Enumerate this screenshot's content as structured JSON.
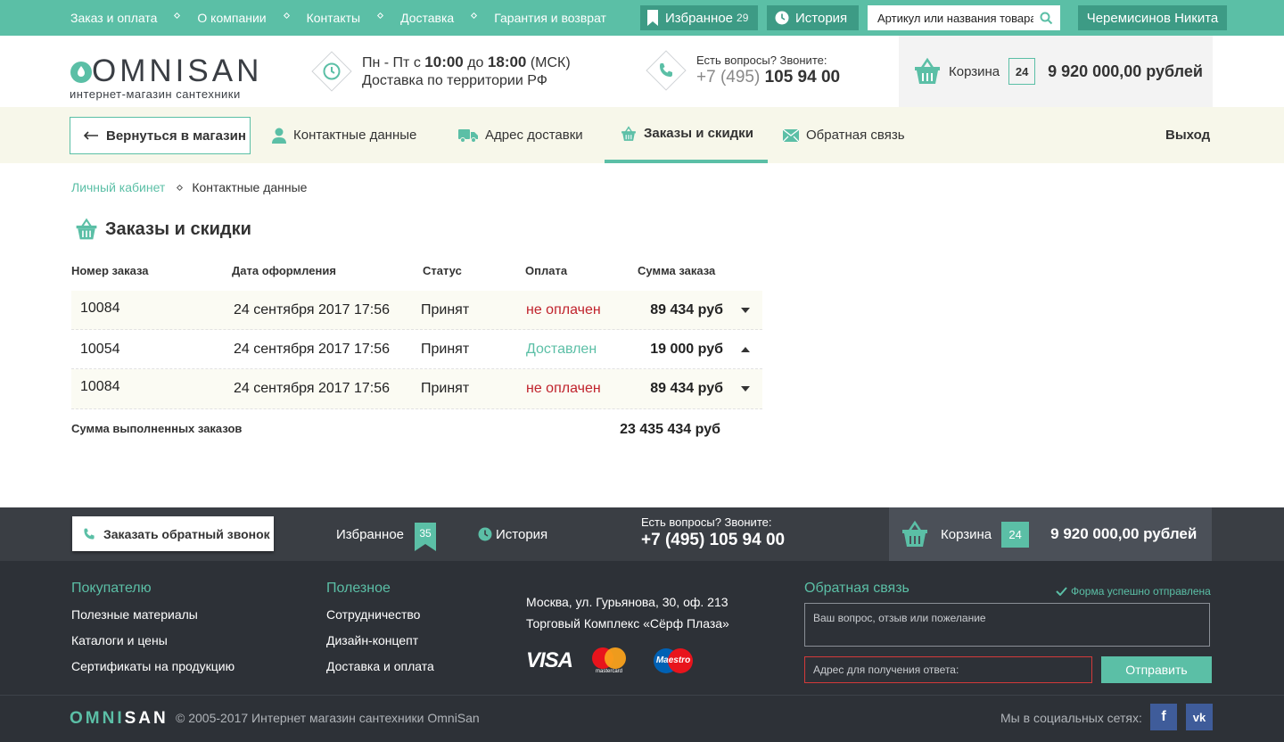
{
  "topbar": {
    "nav": [
      "Заказ и оплата",
      "О компании",
      "Контакты",
      "Доставка",
      "Гарантия и возврат"
    ],
    "favorites_label": "Избранное",
    "favorites_count": "29",
    "history_label": "История",
    "search_placeholder": "Артикул или названия товара",
    "user_name": "Черемисинов Никита"
  },
  "header": {
    "logo_omni": "OMNI",
    "logo_san": "SAN",
    "logo_sub": "интернет-магазин сантехники",
    "hours_prefix": "Пн - Пт с",
    "hours_from": "10:00",
    "hours_mid": "до",
    "hours_to": "18:00",
    "hours_tz": "(МСК)",
    "delivery": "Доставка по территории РФ",
    "phone_question": "Есть вопросы? Звоните:",
    "phone_code": "+7 (495)",
    "phone_number": "105 94 00",
    "cart_label": "Корзина",
    "cart_count": "24",
    "cart_sum": "9 920 000,00 рублей"
  },
  "account_nav": {
    "back": "Вернуться в магазин",
    "tabs": [
      "Контактные данные",
      "Адрес доставки",
      "Заказы и скидки",
      "Обратная связь"
    ],
    "active_tab": "Заказы и скидки",
    "logout": "Выход"
  },
  "breadcrumb": [
    "Личный кабинет",
    "Контактные данные"
  ],
  "page_title": "Заказы и скидки",
  "orders": {
    "headers": [
      "Номер заказа",
      "Дата оформления",
      "Статус",
      "Оплата",
      "Сумма заказа"
    ],
    "rows": [
      {
        "number": "10084",
        "date": "24 сентября 2017 17:56",
        "status": "Принят",
        "payment": "не оплачен",
        "sum": "89 434 руб",
        "expanded": false
      },
      {
        "number": "10054",
        "date": "24 сентября 2017 17:56",
        "status": "Принят",
        "payment": "Доставлен",
        "sum": "19 000 руб",
        "expanded": true
      },
      {
        "number": "10084",
        "date": "24 сентября 2017 17:56",
        "status": "Принят",
        "payment": "не оплачен",
        "sum": "89 434 руб",
        "expanded": false
      }
    ],
    "total_label": "Сумма выполненных заказов",
    "total_value": "23 435 434 руб"
  },
  "footer_bar": {
    "callback": "Заказать обратный звонок",
    "favorites_label": "Избранное",
    "favorites_count": "35",
    "history_label": "История",
    "phone_question": "Есть вопросы? Звоните:",
    "phone": "+7 (495) 105 94 00",
    "cart_label": "Корзина",
    "cart_count": "24",
    "cart_sum": "9 920 000,00 рублей"
  },
  "footer": {
    "col1_title": "Покупателю",
    "col1_links": [
      "Полезные материалы",
      "Каталоги и цены",
      "Сертификаты на продукцию"
    ],
    "col2_title": "Полезное",
    "col2_links": [
      "Сотрудничество",
      "Дизайн-концепт",
      "Доставка и оплата"
    ],
    "address_line1": "Москва, ул. Гурьянова, 30, оф. 213",
    "address_line2": "Торговый Комплекс «Сёрф Плаза»",
    "payments": [
      "VISA",
      "mastercard",
      "Maestro"
    ],
    "feedback_title": "Обратная связь",
    "feedback_success": "Форма успешно отправлена",
    "feedback_placeholder": "Ваш вопрос, отзыв или пожелание",
    "email_placeholder": "Адрес для получения ответа:",
    "send": "Отправить",
    "logo_omni": "OMNI",
    "logo_san": "SAN",
    "copyright": "© 2005-2017 Интернет магазин сантехники OmniSan",
    "social_label": "Мы в социальных сетях:",
    "social": [
      "f",
      "vk"
    ]
  },
  "colors": {
    "accent": "#5bbfa6",
    "accent_dark": "#3d9b85",
    "unpaid": "#c0232c",
    "footer_bg": "#2d3137",
    "footer_bar_bg": "#3a3e44"
  }
}
